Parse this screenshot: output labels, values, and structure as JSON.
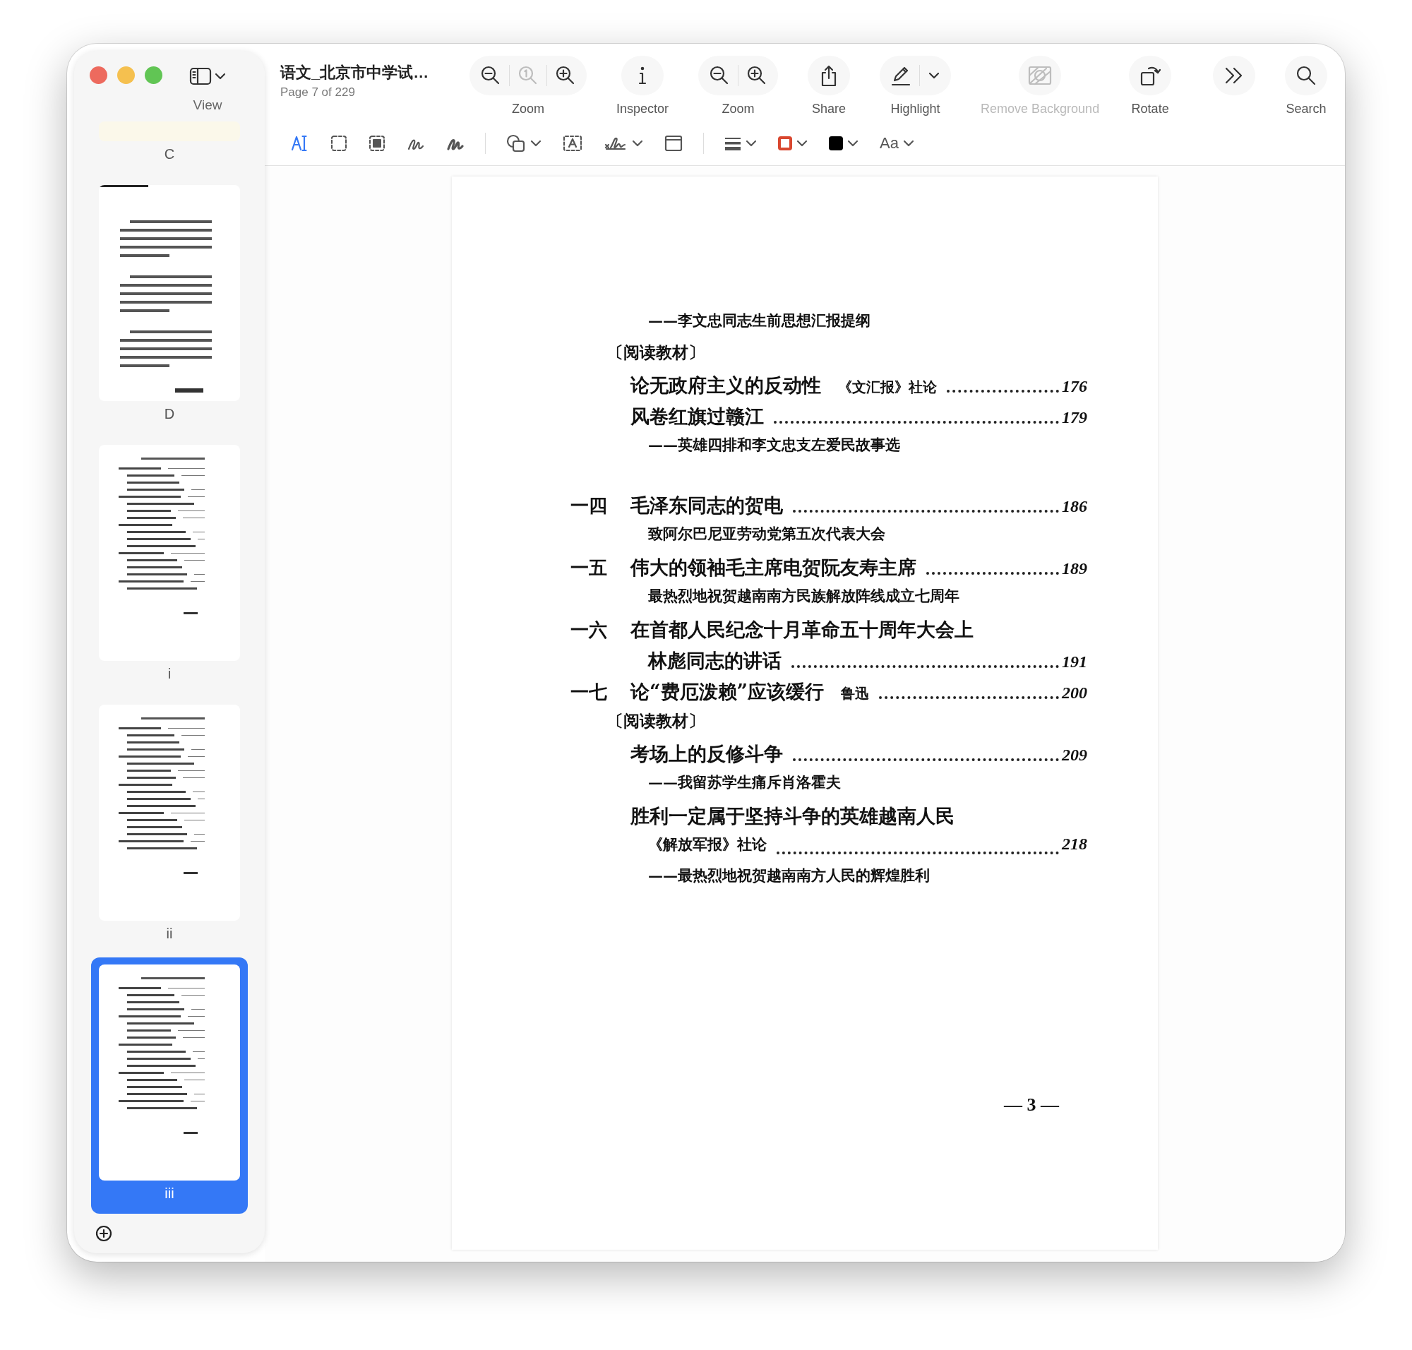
{
  "sidebar": {
    "view_label": "View",
    "thumbnails": [
      {
        "label": "C",
        "kind": "cover",
        "selected": false
      },
      {
        "label": "D",
        "kind": "prose",
        "selected": false
      },
      {
        "label": "i",
        "kind": "contents",
        "selected": false
      },
      {
        "label": "ii",
        "kind": "contents",
        "selected": false
      },
      {
        "label": "iii",
        "kind": "contents",
        "selected": true
      }
    ]
  },
  "document": {
    "title": "语文_北京市中学试…",
    "page_info": "Page 7 of 229"
  },
  "toolbar": {
    "groups": [
      {
        "label": "Zoom",
        "buttons": [
          {
            "disabled": false
          },
          {
            "disabled": true
          },
          {
            "disabled": false
          }
        ]
      },
      {
        "label": "Inspector",
        "buttons": [
          {
            "disabled": false
          }
        ]
      },
      {
        "label": "Zoom",
        "buttons": [
          {
            "disabled": false
          },
          {
            "disabled": false
          }
        ]
      },
      {
        "label": "Share",
        "buttons": [
          {
            "disabled": false
          }
        ]
      },
      {
        "label": "Highlight",
        "buttons": [
          {
            "disabled": false
          },
          {
            "disabled": false
          }
        ]
      },
      {
        "label": "Remove Background",
        "disabled": true,
        "buttons": [
          {
            "disabled": true
          }
        ]
      },
      {
        "label": "Rotate",
        "buttons": [
          {
            "disabled": false
          }
        ]
      },
      {
        "buttons": [
          {
            "disabled": false
          }
        ]
      },
      {
        "label": "Search",
        "buttons": [
          {
            "disabled": false
          }
        ]
      }
    ]
  },
  "markup": [
    {
      "kind": "tool",
      "selected": true
    },
    {
      "kind": "tool",
      "selected": false
    },
    {
      "kind": "tool",
      "selected": false
    },
    {
      "kind": "tool",
      "selected": false
    },
    {
      "kind": "tool",
      "selected": false
    },
    {
      "kind": "separator"
    },
    {
      "kind": "menu"
    },
    {
      "kind": "button"
    },
    {
      "kind": "menu"
    },
    {
      "kind": "button"
    },
    {
      "kind": "separator"
    },
    {
      "kind": "menu"
    },
    {
      "kind": "border",
      "color": "#d9472f"
    },
    {
      "kind": "fill",
      "color": "#000000"
    },
    {
      "kind": "font",
      "label": "Aa"
    }
  ],
  "page": {
    "blocks": [
      {
        "lines": [
          {
            "kind": "subtitle",
            "text": "——李文忠同志生前思想汇报提纲"
          },
          {
            "kind": "section",
            "text": "〔阅读教材〕"
          },
          {
            "kind": "entry",
            "text": "论无政府主义的反动性",
            "byline": "《文汇报》社论",
            "page": "176"
          },
          {
            "kind": "entry",
            "text": "风卷红旗过赣江",
            "page": "179"
          },
          {
            "kind": "subtitle",
            "text": "——英雄四排和李文忠支左爱民故事选"
          }
        ]
      },
      {
        "lines": [
          {
            "kind": "entry",
            "number": "一四",
            "text": "毛泽东同志的贺电",
            "page": "186"
          },
          {
            "kind": "subtitle",
            "text": "致阿尔巴尼亚劳动党第五次代表大会"
          },
          {
            "kind": "entry",
            "number": "一五",
            "text": "伟大的领袖毛主席电贺阮友寿主席",
            "page": "189"
          },
          {
            "kind": "subtitle",
            "text": "最热烈地祝贺越南南方民族解放阵线成立七周年"
          },
          {
            "kind": "entry",
            "number": "一六",
            "text": "在首都人民纪念十月革命五十周年大会上"
          },
          {
            "kind": "continuation",
            "text": "林彪同志的讲话",
            "page": "191"
          },
          {
            "kind": "entry",
            "number": "一七",
            "text": "论“费厄泼赖”应该缓行",
            "byline": "鲁迅",
            "page": "200"
          },
          {
            "kind": "section",
            "text": "〔阅读教材〕"
          },
          {
            "kind": "entry",
            "text": "考场上的反修斗争",
            "page": "209"
          },
          {
            "kind": "subtitle",
            "text": "——我留苏学生痛斥肖洛霍夫"
          },
          {
            "kind": "entry",
            "text": "胜利一定属于坚持斗争的英雄越南人民"
          },
          {
            "kind": "subtitle",
            "text": "《解放军报》社论",
            "page": "218"
          },
          {
            "kind": "subtitle",
            "text": "——最热烈地祝贺越南南方人民的辉煌胜利"
          }
        ]
      }
    ],
    "folio": "— 3 —"
  }
}
